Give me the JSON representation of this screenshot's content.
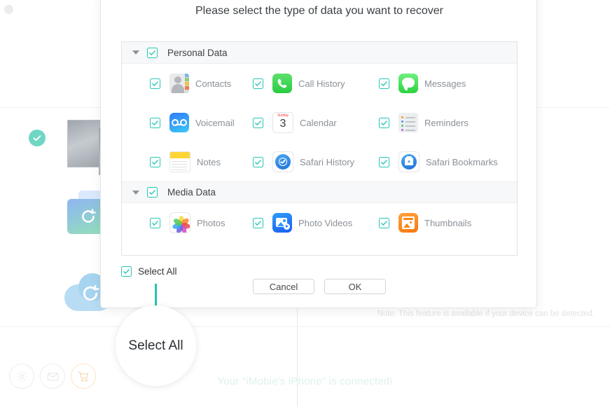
{
  "window": {
    "connected_status": "Your \"iMobie's iPhone\" is connected!",
    "note": "Note: This feature is available if your device can be detected.",
    "bottom_icons": [
      {
        "name": "gear-icon",
        "label": "Settings"
      },
      {
        "name": "mail-icon",
        "label": "Feedback"
      },
      {
        "name": "cart-icon",
        "label": "Store"
      }
    ]
  },
  "dialog": {
    "title": "Please select the type of data you want to recover",
    "groups": [
      {
        "label": "Personal Data",
        "checked": true,
        "expanded": true,
        "rows": [
          [
            {
              "label": "Contacts",
              "icon": "contacts-icon",
              "checked": true
            },
            {
              "label": "Call History",
              "icon": "call-history-icon",
              "checked": true
            },
            {
              "label": "Messages",
              "icon": "messages-icon",
              "checked": true
            }
          ],
          [
            {
              "label": "Voicemail",
              "icon": "voicemail-icon",
              "checked": true
            },
            {
              "label": "Calendar",
              "icon": "calendar-icon",
              "checked": true
            },
            {
              "label": "Reminders",
              "icon": "reminders-icon",
              "checked": true
            }
          ],
          [
            {
              "label": "Notes",
              "icon": "notes-icon",
              "checked": true
            },
            {
              "label": "Safari History",
              "icon": "safari-history-icon",
              "checked": true
            },
            {
              "label": "Safari Bookmarks",
              "icon": "safari-bookmarks-icon",
              "checked": true
            }
          ]
        ]
      },
      {
        "label": "Media Data",
        "checked": true,
        "expanded": true,
        "rows": [
          [
            {
              "label": "Photos",
              "icon": "photos-icon",
              "checked": true
            },
            {
              "label": "Photo Videos",
              "icon": "photo-videos-icon",
              "checked": true
            },
            {
              "label": "Thumbnails",
              "icon": "thumbnails-icon",
              "checked": true
            }
          ]
        ]
      }
    ],
    "select_all_label": "Select All",
    "select_all_checked": true,
    "cancel_label": "Cancel",
    "ok_label": "OK"
  },
  "calendar_icon": {
    "weekday": "Sunday",
    "day": "3"
  },
  "annotation": {
    "label": "Select All"
  },
  "colors": {
    "checkbox": "#27c6b5",
    "annotation": "#25c2ae",
    "status_text": "#ddf2ee",
    "note_text": "#dfe2e5"
  }
}
